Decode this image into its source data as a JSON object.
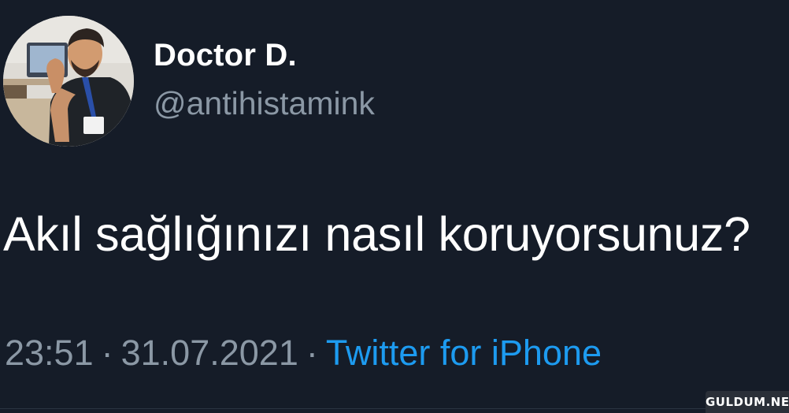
{
  "tweet": {
    "author": {
      "display_name": "Doctor D.",
      "handle": "@antihistamink",
      "avatar_icon": "profile-photo"
    },
    "text": "Akıl sağlığınızı nasıl koruyorsunuz?",
    "time": "23:51",
    "date": "31.07.2021",
    "separator": "·",
    "source": "Twitter for iPhone"
  },
  "watermark": {
    "text": "GULDUM.NET"
  },
  "colors": {
    "background": "#151c28",
    "secondary_text": "#8b98a5",
    "link": "#1d9bf0"
  }
}
